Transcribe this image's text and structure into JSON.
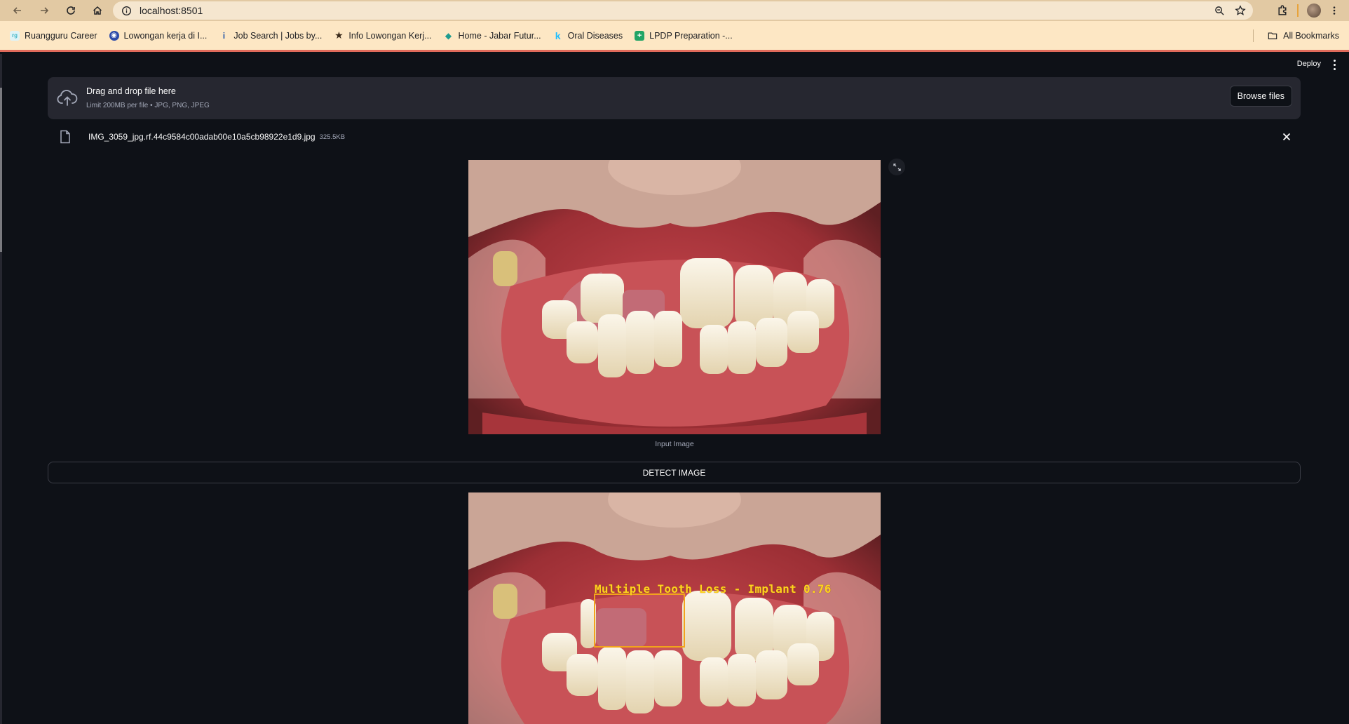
{
  "browser": {
    "url": "localhost:8501",
    "bookmarks": [
      {
        "label": "Ruangguru Career",
        "icon": "ruangguru-icon",
        "color": "#3fb6c9"
      },
      {
        "label": "Lowongan kerja di I...",
        "icon": "globe-icon",
        "color": "#2d4aa8"
      },
      {
        "label": "Job Search | Jobs by...",
        "icon": "indeed-icon",
        "color": "#2557a7"
      },
      {
        "label": "Info Lowongan Kerj...",
        "icon": "star-icon",
        "color": "#3a2a1a"
      },
      {
        "label": "Home - Jabar Futur...",
        "icon": "jabar-icon",
        "color": "#1f9c8f"
      },
      {
        "label": "Oral Diseases",
        "icon": "kaggle-icon",
        "color": "#20beff"
      },
      {
        "label": "LPDP Preparation -...",
        "icon": "sheets-icon",
        "color": "#23a566"
      }
    ],
    "all_bookmarks": "All Bookmarks"
  },
  "app": {
    "deploy_label": "Deploy",
    "uploader": {
      "title": "Drag and drop file here",
      "hint": "Limit 200MB per file • JPG, PNG, JPEG",
      "browse_label": "Browse files"
    },
    "file": {
      "name": "IMG_3059_jpg.rf.44c9584c00adab00e10a5cb98922e1d9.jpg",
      "size": "325.5KB"
    },
    "input_caption": "Input Image",
    "detect_label": "DETECT IMAGE",
    "detection": {
      "label": "Multiple Tooth Loss - Implant 0.76",
      "box_color": "#f2a31c",
      "text_color": "#ffd21f"
    }
  }
}
